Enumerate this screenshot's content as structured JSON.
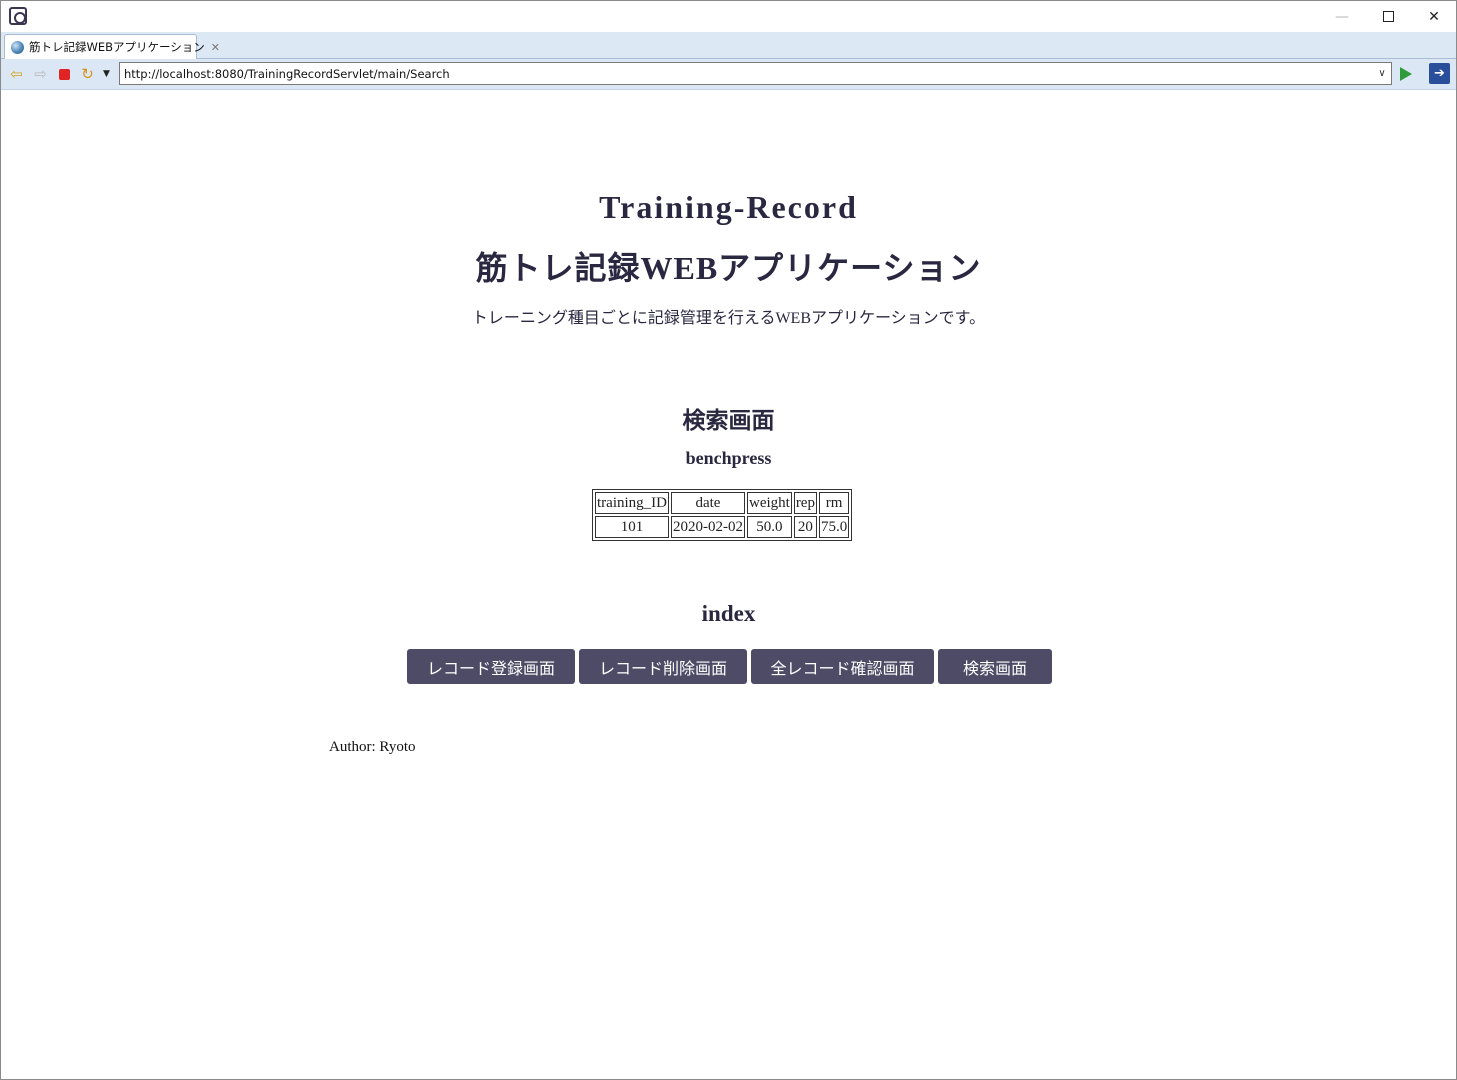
{
  "window": {
    "icons": {
      "app": "eclipse-app-icon",
      "minimize": "minimize-icon",
      "maximize": "maximize-icon",
      "close": "close-icon"
    },
    "minimize_glyph": "—",
    "close_glyph": "✕"
  },
  "tab": {
    "label": "筋トレ記録WEBアプリケーション",
    "close_glyph": "✕"
  },
  "toolbar": {
    "back_glyph": "⇦",
    "forward_glyph": "⇨",
    "refresh_glyph": "↻",
    "dropdown_glyph": "▼",
    "url": "http://localhost:8080/TrainingRecordServlet/main/Search",
    "url_dropdown_glyph": "∨",
    "external_glyph": "➔"
  },
  "page": {
    "title_en": "Training-Record",
    "title_jp": "筋トレ記録WEBアプリケーション",
    "description": "トレーニング種目ごとに記録管理を行えるWEBアプリケーションです。",
    "search_heading": "検索画面",
    "exercise": "benchpress",
    "table": {
      "headers": [
        "training_ID",
        "date",
        "weight",
        "rep",
        "rm"
      ],
      "rows": [
        [
          "101",
          "2020-02-02",
          "50.0",
          "20",
          "75.0"
        ]
      ]
    },
    "index_heading": "index",
    "buttons": [
      "レコード登録画面",
      "レコード削除画面",
      "全レコード確認画面",
      "検索画面"
    ],
    "author": "Author: Ryoto"
  }
}
